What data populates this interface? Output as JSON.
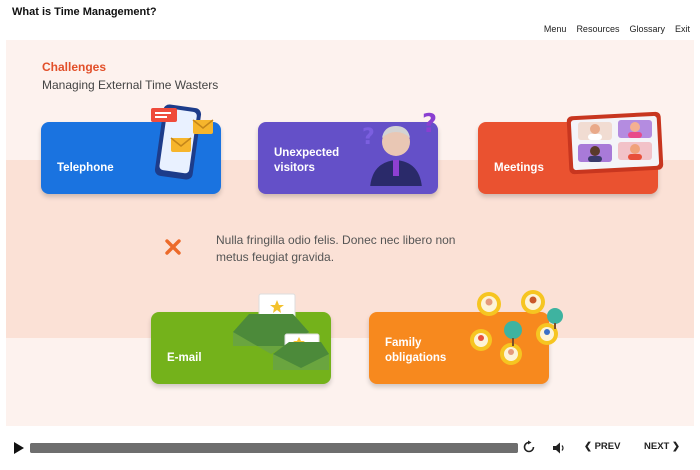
{
  "header": {
    "course_title": "What is Time Management?",
    "nav": [
      "Menu",
      "Resources",
      "Glossary",
      "Exit"
    ]
  },
  "slide": {
    "heading": "Challenges",
    "subheading": "Managing External Time Wasters",
    "cards": [
      {
        "label": "Telephone",
        "color": "#1a73e0"
      },
      {
        "label": "Unexpected visitors",
        "color": "#6450c8"
      },
      {
        "label": "Meetings",
        "color": "#ea5230"
      },
      {
        "label": "E-mail",
        "color": "#74b21b"
      },
      {
        "label": "Family obligations",
        "color": "#f7891e"
      }
    ],
    "feedback_icon": "close-icon",
    "feedback_text": "Nulla fringilla odio felis. Donec nec libero non metus feugiat gravida."
  },
  "player": {
    "progress": 1.0,
    "prev_label": "❮ PREV",
    "next_label": "NEXT ❯"
  },
  "colors": {
    "accent": "#e2502a",
    "slide_bg": "#fdf2ee",
    "band_bg": "#fbe1d6"
  }
}
